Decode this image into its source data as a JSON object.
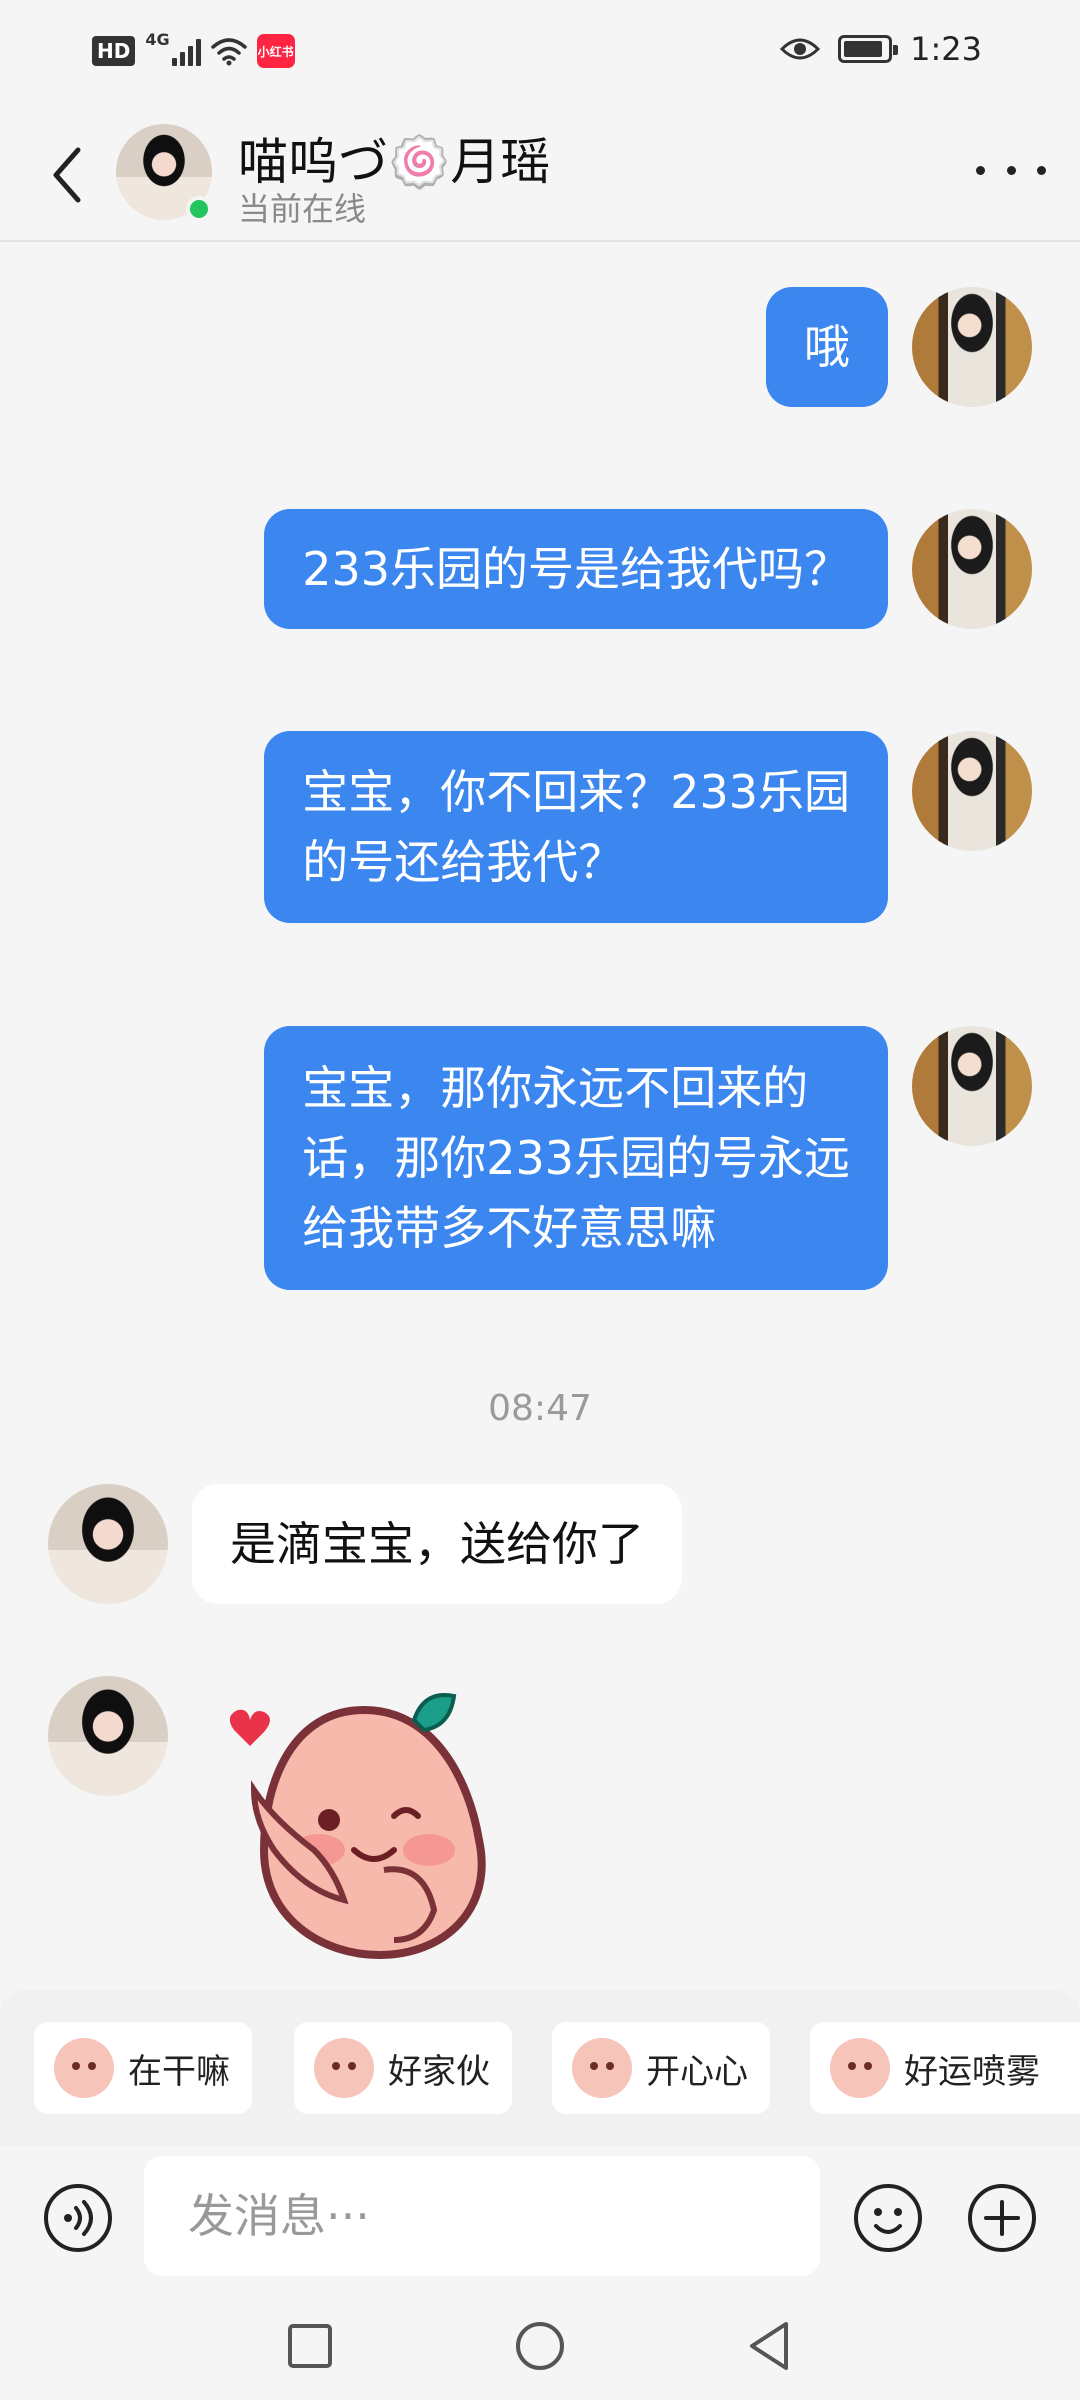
{
  "status_bar": {
    "hd": "HD",
    "network": "4G",
    "app_badge": "小红书",
    "time": "1:23",
    "battery_level": 0.9
  },
  "header": {
    "contact_name": "喵呜づ🍥月瑶",
    "contact_status": "当前在线",
    "online_color": "#22c55e"
  },
  "messages": [
    {
      "side": "out",
      "text": "哦"
    },
    {
      "side": "out",
      "text": "233乐园的号是给我代吗？"
    },
    {
      "side": "out",
      "lines": [
        "宝宝，你不回来？233乐园",
        "的号还给我代？"
      ]
    },
    {
      "side": "out",
      "lines": [
        "宝宝，那你永远不回来的",
        "话，那你233乐园的号永远",
        "给我带多不好意思嘛"
      ]
    },
    {
      "side": "in",
      "text": "是滴宝宝，送给你了"
    },
    {
      "side": "in",
      "sticker": "blushing-peach-sticker"
    }
  ],
  "timestamp": "08:47",
  "quick_replies": [
    "在干嘛",
    "好家伙",
    "开心心",
    "好运喷雾"
  ],
  "input": {
    "placeholder": "发消息···"
  },
  "colors": {
    "bubble_out": "#3b86ef",
    "bubble_in": "#ffffff",
    "background": "#f5f5f5"
  }
}
